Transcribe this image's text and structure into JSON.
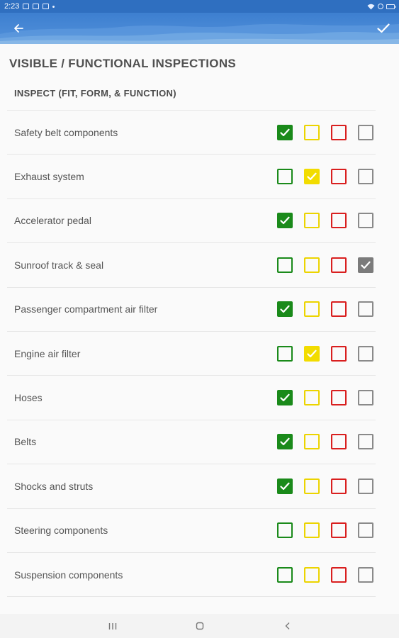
{
  "status_bar": {
    "time": "2:23"
  },
  "app_bar": {
    "back_icon": "arrow-left-icon",
    "done_icon": "check-icon"
  },
  "page_title": "VISIBLE / FUNCTIONAL INSPECTIONS",
  "section_header": "INSPECT (FIT, FORM, & FUNCTION)",
  "colors": {
    "green": "#1a8a1a",
    "yellow": "#f2dc00",
    "red": "#d91f1f",
    "gray": "#7b7b7b",
    "app_bar": "#3d7fd0"
  },
  "rows": [
    {
      "label": "Safety belt components",
      "selected": "green"
    },
    {
      "label": "Exhaust system",
      "selected": "yellow"
    },
    {
      "label": "Accelerator pedal",
      "selected": "green"
    },
    {
      "label": "Sunroof track & seal",
      "selected": "gray"
    },
    {
      "label": "Passenger compartment air filter",
      "selected": "green"
    },
    {
      "label": "Engine air filter",
      "selected": "yellow"
    },
    {
      "label": "Hoses",
      "selected": "green"
    },
    {
      "label": "Belts",
      "selected": "green"
    },
    {
      "label": "Shocks and struts",
      "selected": "green"
    },
    {
      "label": "Steering components",
      "selected": ""
    },
    {
      "label": "Suspension components",
      "selected": ""
    }
  ],
  "nav_bar": {
    "recents_icon": "recents-icon",
    "home_icon": "home-icon",
    "back_icon": "back-chevron-icon"
  }
}
